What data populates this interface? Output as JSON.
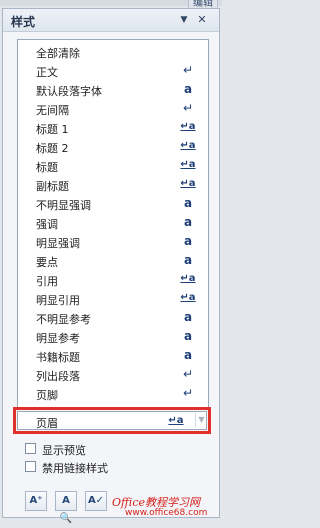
{
  "top_right_tab": "编辑",
  "pane": {
    "title": "样式",
    "dropdown_icon": "triangle-down",
    "close_icon": "x",
    "styles": [
      {
        "name": "全部清除",
        "icon": ""
      },
      {
        "name": "正文",
        "icon": "↵"
      },
      {
        "name": "默认段落字体",
        "icon": "a"
      },
      {
        "name": "无间隔",
        "icon": "↵"
      },
      {
        "name": "标题 1",
        "icon": "↵a"
      },
      {
        "name": "标题 2",
        "icon": "↵a"
      },
      {
        "name": "标题",
        "icon": "↵a"
      },
      {
        "name": "副标题",
        "icon": "↵a"
      },
      {
        "name": "不明显强调",
        "icon": "a"
      },
      {
        "name": "强调",
        "icon": "a"
      },
      {
        "name": "明显强调",
        "icon": "a"
      },
      {
        "name": "要点",
        "icon": "a"
      },
      {
        "name": "引用",
        "icon": "↵a"
      },
      {
        "name": "明显引用",
        "icon": "↵a"
      },
      {
        "name": "不明显参考",
        "icon": "a"
      },
      {
        "name": "明显参考",
        "icon": "a"
      },
      {
        "name": "书籍标题",
        "icon": "a"
      },
      {
        "name": "列出段落",
        "icon": "↵"
      },
      {
        "name": "页脚",
        "icon": "↵"
      }
    ],
    "selected_style": {
      "name": "页眉",
      "icon": "↵a"
    },
    "options": {
      "show_preview": "显示预览",
      "disable_linked_styles": "禁用链接样式"
    }
  },
  "watermark": "Office教程学习网",
  "watermark_url": "www.office68.com"
}
